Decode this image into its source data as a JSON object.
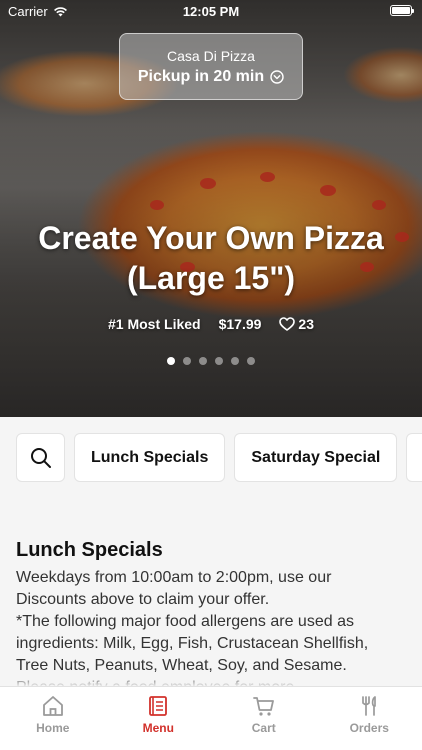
{
  "status_bar": {
    "carrier": "Carrier",
    "time": "12:05 PM"
  },
  "store": {
    "name": "Casa Di Pizza",
    "pickup": "Pickup in 20 min"
  },
  "hero": {
    "title_line1": "Create Your Own Pizza",
    "title_line2": "(Large 15\")",
    "rank": "#1 Most Liked",
    "price": "$17.99",
    "likes": "23",
    "slide_count": 6,
    "active_slide": 1
  },
  "categories": {
    "items": [
      "Lunch Specials",
      "Saturday Special"
    ]
  },
  "section": {
    "title": "Lunch Specials",
    "desc_lines": [
      "Weekdays from 10:00am to 2:00pm, use our",
      "Discounts above to claim your offer.",
      "*The following major food allergens are used as",
      "ingredients: Milk, Egg, Fish, Crustacean Shellfish,",
      "Tree Nuts, Peanuts, Wheat, Soy, and Sesame.",
      "Please notify a food employee for more"
    ]
  },
  "tabs": [
    {
      "label": "Home",
      "icon": "home-icon",
      "active": false
    },
    {
      "label": "Menu",
      "icon": "menu-icon",
      "active": true
    },
    {
      "label": "Cart",
      "icon": "cart-icon",
      "active": false
    },
    {
      "label": "Orders",
      "icon": "utensils-icon",
      "active": false
    }
  ],
  "colors": {
    "accent": "#d2312b",
    "inactive_tab": "#9a9a9a"
  }
}
